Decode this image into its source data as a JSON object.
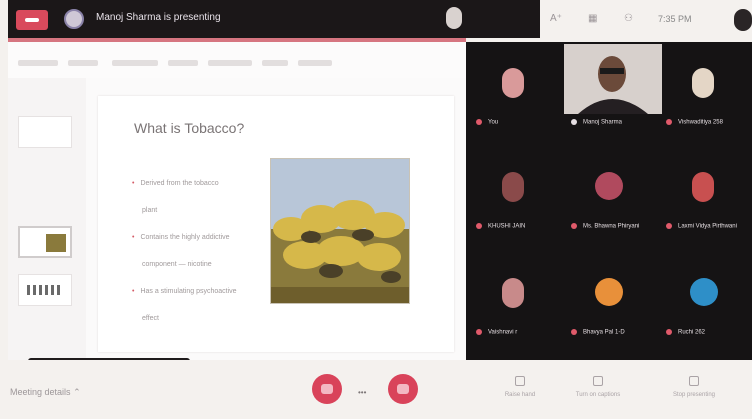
{
  "topbar": {
    "presenting_text": "Manoj Sharma is presenting",
    "share_text": "",
    "clock": "7:35 PM"
  },
  "slide": {
    "title": "What is Tobacco?",
    "bullets": [
      "Derived from the tobacco",
      "plant",
      "Contains the highly addictive",
      "component — nicotine",
      "Has a stimulating psychoactive",
      "effect"
    ]
  },
  "toast": "",
  "participants": [
    {
      "name": "You",
      "color": "#d99a9a"
    },
    {
      "name": "Manoj Sharma",
      "color": "#b08a7a"
    },
    {
      "name": "Vishwaditiya 258",
      "color": "#e4d6c6"
    },
    {
      "name": "KHUSHI JAIN",
      "color": "#8a4a4a"
    },
    {
      "name": "Ms. Bhawna Phiryani",
      "color": "#b04a5e"
    },
    {
      "name": "Laxmi Vidya Pirthwani",
      "color": "#c85050"
    },
    {
      "name": "Vaishnavi r",
      "color": "#c88a8a"
    },
    {
      "name": "Bhavya Pal 1-D",
      "color": "#e8903a"
    },
    {
      "name": "Ruchi 262",
      "color": "#2e8fc8"
    }
  ],
  "bottombar": {
    "meeting_details": "Meeting details",
    "tools": [
      {
        "label": "Raise hand",
        "icon": "hand-icon"
      },
      {
        "label": "Turn on captions",
        "icon": "captions-icon"
      },
      {
        "label": "Stop presenting",
        "icon": "present-icon"
      }
    ]
  },
  "colors": {
    "accent": "#d9435a",
    "bar": "#1b1718"
  }
}
